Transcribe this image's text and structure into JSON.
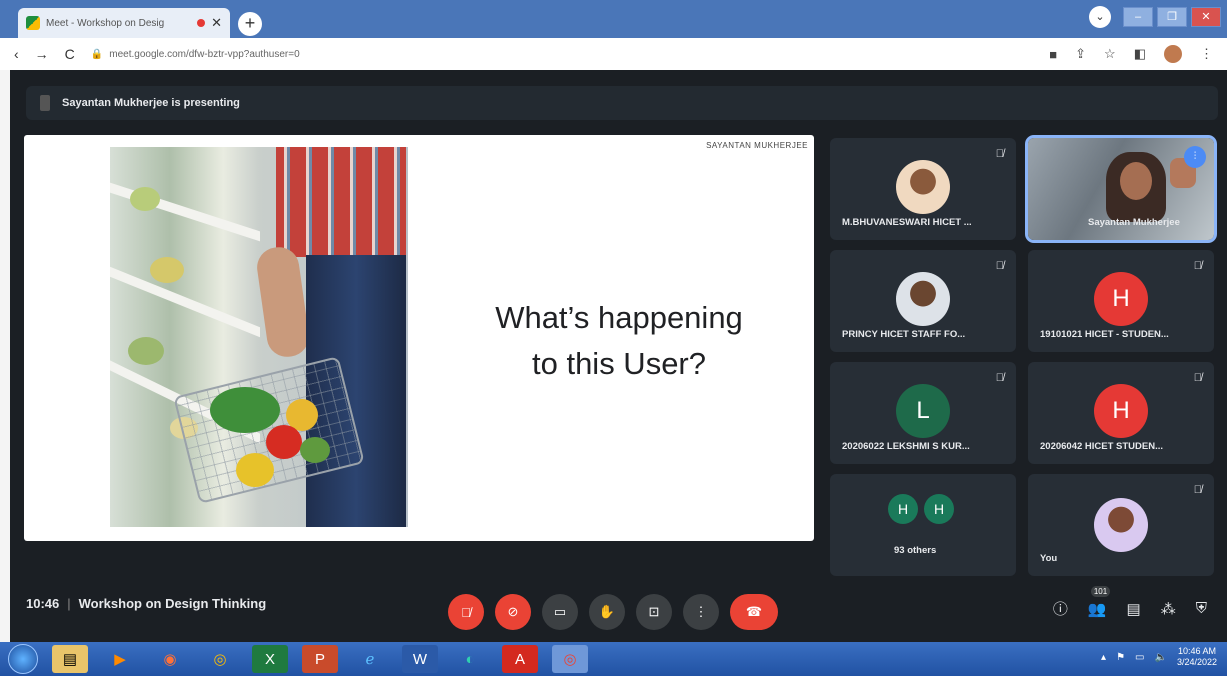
{
  "browser": {
    "tab_title": "Meet - Workshop on Desig",
    "new_tab": "+",
    "url": "meet.google.com/dfw-bztr-vpp?authuser=0"
  },
  "meet": {
    "presenting_banner": "Sayantan Mukherjee is presenting",
    "slide": {
      "author": "SAYANTAN MUKHERJEE",
      "heading_line1": "What’s happening",
      "heading_line2": "to this User?"
    },
    "participants": [
      {
        "name": "M.BHUVANESWARI HICET ...",
        "muted": true
      },
      {
        "name": "Sayantan Mukherjee",
        "speaking": true
      },
      {
        "name": "PRINCY HICET STAFF FO...",
        "muted": true
      },
      {
        "name": "19101021 HICET - STUDEN...",
        "initial": "H",
        "muted": true
      },
      {
        "name": "20206022 LEKSHMI S KUR...",
        "initial": "L",
        "muted": true
      },
      {
        "name": "20206042 HICET STUDEN...",
        "initial": "H",
        "muted": true
      },
      {
        "name": "93 others",
        "initials": [
          "H",
          "H"
        ]
      },
      {
        "name": "You",
        "muted": true
      }
    ],
    "meeting_time": "10:46",
    "meeting_sep": "|",
    "meeting_title": "Workshop on Design Thinking",
    "participant_count": "101"
  },
  "icons": {
    "mic_off": "mic-off-icon",
    "cam_off": "camera-off-icon",
    "captions": "captions-icon",
    "raise_hand": "hand-icon",
    "present": "present-icon",
    "more": "more-icon",
    "hangup": "hangup-icon"
  },
  "taskbar": {
    "time": "10:46 AM",
    "date": "3/24/2022"
  },
  "colors": {
    "meet_bg": "#1b1f24",
    "tile_bg": "#272e36",
    "danger": "#ea4335",
    "tab_bar": "#4a76b8"
  }
}
